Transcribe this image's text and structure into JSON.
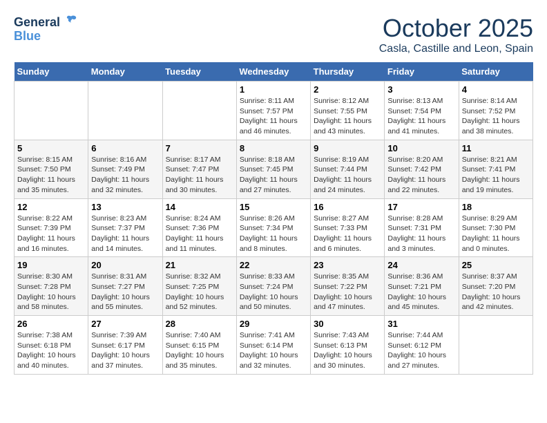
{
  "logo": {
    "line1": "General",
    "line2": "Blue"
  },
  "title": "October 2025",
  "location": "Casla, Castille and Leon, Spain",
  "days_header": [
    "Sunday",
    "Monday",
    "Tuesday",
    "Wednesday",
    "Thursday",
    "Friday",
    "Saturday"
  ],
  "weeks": [
    [
      {
        "day": "",
        "info": ""
      },
      {
        "day": "",
        "info": ""
      },
      {
        "day": "",
        "info": ""
      },
      {
        "day": "1",
        "info": "Sunrise: 8:11 AM\nSunset: 7:57 PM\nDaylight: 11 hours\nand 46 minutes."
      },
      {
        "day": "2",
        "info": "Sunrise: 8:12 AM\nSunset: 7:55 PM\nDaylight: 11 hours\nand 43 minutes."
      },
      {
        "day": "3",
        "info": "Sunrise: 8:13 AM\nSunset: 7:54 PM\nDaylight: 11 hours\nand 41 minutes."
      },
      {
        "day": "4",
        "info": "Sunrise: 8:14 AM\nSunset: 7:52 PM\nDaylight: 11 hours\nand 38 minutes."
      }
    ],
    [
      {
        "day": "5",
        "info": "Sunrise: 8:15 AM\nSunset: 7:50 PM\nDaylight: 11 hours\nand 35 minutes."
      },
      {
        "day": "6",
        "info": "Sunrise: 8:16 AM\nSunset: 7:49 PM\nDaylight: 11 hours\nand 32 minutes."
      },
      {
        "day": "7",
        "info": "Sunrise: 8:17 AM\nSunset: 7:47 PM\nDaylight: 11 hours\nand 30 minutes."
      },
      {
        "day": "8",
        "info": "Sunrise: 8:18 AM\nSunset: 7:45 PM\nDaylight: 11 hours\nand 27 minutes."
      },
      {
        "day": "9",
        "info": "Sunrise: 8:19 AM\nSunset: 7:44 PM\nDaylight: 11 hours\nand 24 minutes."
      },
      {
        "day": "10",
        "info": "Sunrise: 8:20 AM\nSunset: 7:42 PM\nDaylight: 11 hours\nand 22 minutes."
      },
      {
        "day": "11",
        "info": "Sunrise: 8:21 AM\nSunset: 7:41 PM\nDaylight: 11 hours\nand 19 minutes."
      }
    ],
    [
      {
        "day": "12",
        "info": "Sunrise: 8:22 AM\nSunset: 7:39 PM\nDaylight: 11 hours\nand 16 minutes."
      },
      {
        "day": "13",
        "info": "Sunrise: 8:23 AM\nSunset: 7:37 PM\nDaylight: 11 hours\nand 14 minutes."
      },
      {
        "day": "14",
        "info": "Sunrise: 8:24 AM\nSunset: 7:36 PM\nDaylight: 11 hours\nand 11 minutes."
      },
      {
        "day": "15",
        "info": "Sunrise: 8:26 AM\nSunset: 7:34 PM\nDaylight: 11 hours\nand 8 minutes."
      },
      {
        "day": "16",
        "info": "Sunrise: 8:27 AM\nSunset: 7:33 PM\nDaylight: 11 hours\nand 6 minutes."
      },
      {
        "day": "17",
        "info": "Sunrise: 8:28 AM\nSunset: 7:31 PM\nDaylight: 11 hours\nand 3 minutes."
      },
      {
        "day": "18",
        "info": "Sunrise: 8:29 AM\nSunset: 7:30 PM\nDaylight: 11 hours\nand 0 minutes."
      }
    ],
    [
      {
        "day": "19",
        "info": "Sunrise: 8:30 AM\nSunset: 7:28 PM\nDaylight: 10 hours\nand 58 minutes."
      },
      {
        "day": "20",
        "info": "Sunrise: 8:31 AM\nSunset: 7:27 PM\nDaylight: 10 hours\nand 55 minutes."
      },
      {
        "day": "21",
        "info": "Sunrise: 8:32 AM\nSunset: 7:25 PM\nDaylight: 10 hours\nand 52 minutes."
      },
      {
        "day": "22",
        "info": "Sunrise: 8:33 AM\nSunset: 7:24 PM\nDaylight: 10 hours\nand 50 minutes."
      },
      {
        "day": "23",
        "info": "Sunrise: 8:35 AM\nSunset: 7:22 PM\nDaylight: 10 hours\nand 47 minutes."
      },
      {
        "day": "24",
        "info": "Sunrise: 8:36 AM\nSunset: 7:21 PM\nDaylight: 10 hours\nand 45 minutes."
      },
      {
        "day": "25",
        "info": "Sunrise: 8:37 AM\nSunset: 7:20 PM\nDaylight: 10 hours\nand 42 minutes."
      }
    ],
    [
      {
        "day": "26",
        "info": "Sunrise: 7:38 AM\nSunset: 6:18 PM\nDaylight: 10 hours\nand 40 minutes."
      },
      {
        "day": "27",
        "info": "Sunrise: 7:39 AM\nSunset: 6:17 PM\nDaylight: 10 hours\nand 37 minutes."
      },
      {
        "day": "28",
        "info": "Sunrise: 7:40 AM\nSunset: 6:15 PM\nDaylight: 10 hours\nand 35 minutes."
      },
      {
        "day": "29",
        "info": "Sunrise: 7:41 AM\nSunset: 6:14 PM\nDaylight: 10 hours\nand 32 minutes."
      },
      {
        "day": "30",
        "info": "Sunrise: 7:43 AM\nSunset: 6:13 PM\nDaylight: 10 hours\nand 30 minutes."
      },
      {
        "day": "31",
        "info": "Sunrise: 7:44 AM\nSunset: 6:12 PM\nDaylight: 10 hours\nand 27 minutes."
      },
      {
        "day": "",
        "info": ""
      }
    ]
  ]
}
